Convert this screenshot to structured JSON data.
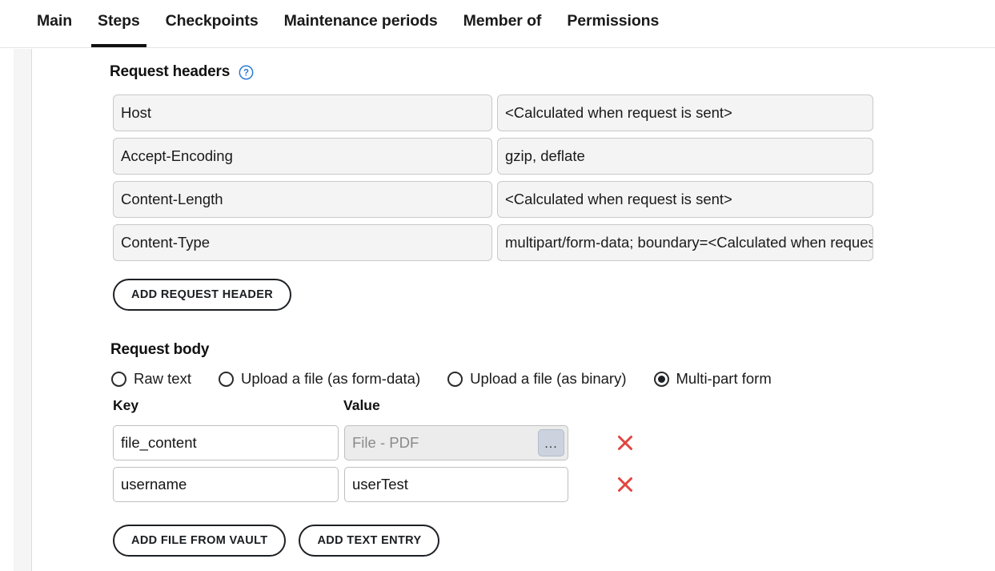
{
  "tabs": [
    {
      "label": "Main",
      "active": false
    },
    {
      "label": "Steps",
      "active": true
    },
    {
      "label": "Checkpoints",
      "active": false
    },
    {
      "label": "Maintenance periods",
      "active": false
    },
    {
      "label": "Member of",
      "active": false
    },
    {
      "label": "Permissions",
      "active": false
    }
  ],
  "request_headers": {
    "title": "Request headers",
    "help_icon": "help-circle-icon",
    "rows": [
      {
        "key": "Host",
        "value": "<Calculated when request is sent>"
      },
      {
        "key": "Accept-Encoding",
        "value": "gzip, deflate"
      },
      {
        "key": "Content-Length",
        "value": "<Calculated when request is sent>"
      },
      {
        "key": "Content-Type",
        "value": "multipart/form-data; boundary=<Calculated when request is sent>"
      }
    ],
    "add_button": "ADD REQUEST HEADER"
  },
  "request_body": {
    "title": "Request body",
    "options": [
      {
        "label": "Raw text",
        "selected": false
      },
      {
        "label": "Upload a file (as form-data)",
        "selected": false
      },
      {
        "label": "Upload a file (as binary)",
        "selected": false
      },
      {
        "label": "Multi-part form",
        "selected": true
      }
    ],
    "columns": {
      "key": "Key",
      "value": "Value"
    },
    "entries": [
      {
        "key": "file_content",
        "value": "File - PDF",
        "is_file_picker": true,
        "browse_label": "...",
        "delete_icon": "close-x-icon"
      },
      {
        "key": "username",
        "value": "userTest",
        "is_file_picker": false,
        "browse_label": "",
        "delete_icon": "close-x-icon"
      }
    ],
    "add_file_button": "ADD FILE FROM VAULT",
    "add_text_button": "ADD TEXT ENTRY"
  },
  "colors": {
    "accent_blue": "#2b7cd3",
    "delete_red": "#e0453f",
    "active_tab_underline": "#111111",
    "disabled_field_bg": "#f4f4f4",
    "browse_button_bg": "#ccd3df"
  }
}
